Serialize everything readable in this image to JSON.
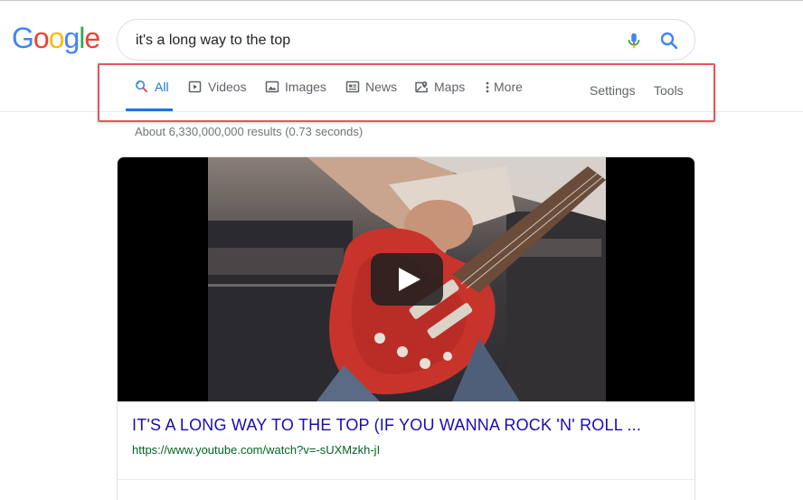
{
  "logo": {
    "letters": [
      "G",
      "o",
      "o",
      "g",
      "l",
      "e"
    ],
    "colors": [
      "#4285f4",
      "#ea4335",
      "#fbbc05",
      "#4285f4",
      "#34a853",
      "#ea4335"
    ]
  },
  "search": {
    "value": "it's a long way to the top",
    "mic_icon": "microphone-icon",
    "search_icon": "magnifier-icon"
  },
  "tabs": [
    {
      "label": "All",
      "icon": "search-icon",
      "active": true
    },
    {
      "label": "Videos",
      "icon": "video-icon",
      "active": false
    },
    {
      "label": "Images",
      "icon": "image-icon",
      "active": false
    },
    {
      "label": "News",
      "icon": "news-icon",
      "active": false
    },
    {
      "label": "Maps",
      "icon": "map-icon",
      "active": false
    },
    {
      "label": "More",
      "icon": "more-vertical-icon",
      "active": false
    }
  ],
  "tools": {
    "settings": "Settings",
    "tools": "Tools"
  },
  "result_stats": "About 6,330,000,000 results (0.73 seconds)",
  "video_result": {
    "title": "IT'S A LONG WAY TO THE TOP (IF YOU WANNA ROCK 'N' ROLL ...",
    "url": "https://www.youtube.com/watch?v=-sUXMzkh-jI"
  },
  "colors": {
    "accent": "#1a73e8",
    "link": "#1a0dab",
    "url_green": "#006621",
    "highlight_box": "#e8545a"
  }
}
